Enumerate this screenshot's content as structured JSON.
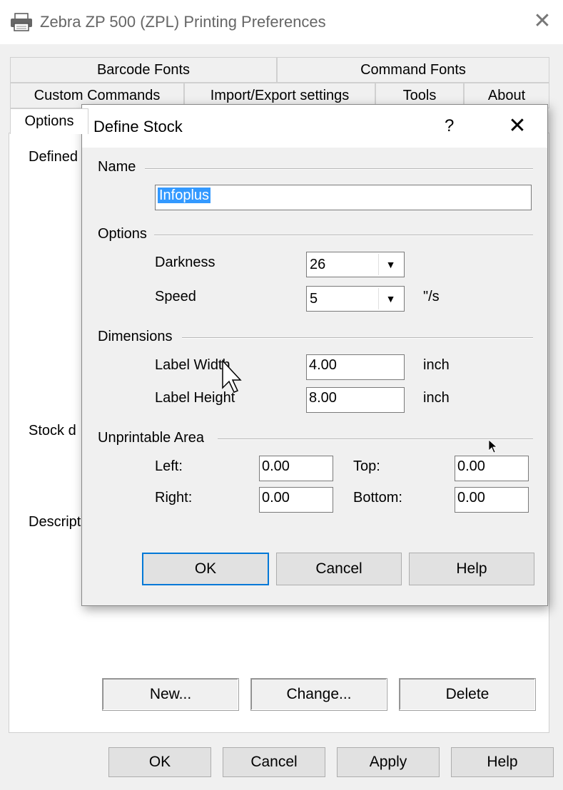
{
  "window": {
    "title": "Zebra ZP 500 (ZPL) Printing Preferences",
    "close_icon": "close-icon"
  },
  "tabs": {
    "row1": [
      "Barcode Fonts",
      "Command Fonts"
    ],
    "row2": [
      "Custom Commands",
      "Import/Export settings",
      "Tools",
      "About"
    ],
    "row3": [
      "Options"
    ]
  },
  "panel": {
    "defined_label": "Defined",
    "stock_label": "Stock d",
    "description_label": "Descript",
    "buttons": {
      "new": "New...",
      "change": "Change...",
      "delete": "Delete"
    }
  },
  "footer": {
    "ok": "OK",
    "cancel": "Cancel",
    "apply": "Apply",
    "help": "Help"
  },
  "dialog": {
    "title": "Define Stock",
    "help_glyph": "?",
    "name_group": "Name",
    "name_value": "Infoplus",
    "options_group": "Options",
    "darkness_label": "Darkness",
    "darkness_value": "26",
    "speed_label": "Speed",
    "speed_value": "5",
    "speed_unit": "\"/s",
    "dimensions_group": "Dimensions",
    "label_width_label": "Label Width",
    "label_width_value": "4.00",
    "label_width_unit": "inch",
    "label_height_label": "Label Height",
    "label_height_value": "8.00",
    "label_height_unit": "inch",
    "unprintable_group": "Unprintable Area",
    "left_label": "Left:",
    "left_value": "0.00",
    "top_label": "Top:",
    "top_value": "0.00",
    "right_label": "Right:",
    "right_value": "0.00",
    "bottom_label": "Bottom:",
    "bottom_value": "0.00",
    "ok": "OK",
    "cancel": "Cancel",
    "help": "Help"
  }
}
